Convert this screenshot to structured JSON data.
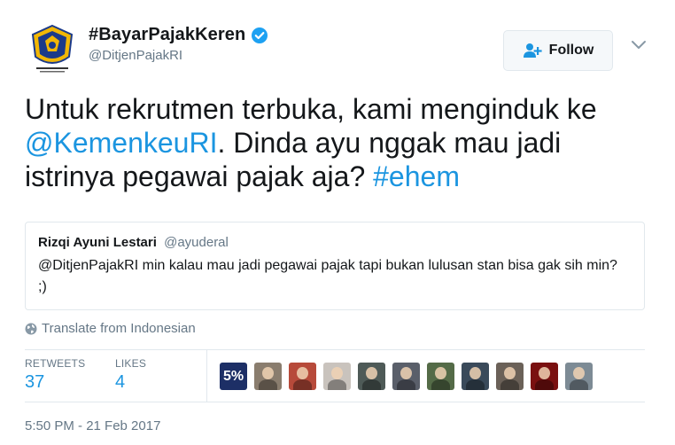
{
  "header": {
    "display_name": "#BayarPajakKeren",
    "handle": "@DitjenPajakRI",
    "avatar_icon": "ministry-of-finance-emblem",
    "verified_icon": "verified-badge-icon",
    "follow_label": "Follow",
    "follow_icon": "add-user-icon",
    "menu_icon": "chevron-down-icon"
  },
  "tweet": {
    "text_before_mention": "Untuk rekrutmen terbuka, kami menginduk ke ",
    "mention": "@KemenkeuRI",
    "text_after_mention": ". Dinda ayu nggak mau jadi istrinya pegawai pajak aja? ",
    "hashtag": "#ehem"
  },
  "quote": {
    "name": "Rizqi Ayuni Lestari",
    "handle": "@ayuderal",
    "text": "@DitjenPajakRI min kalau mau jadi pegawai pajak tapi bukan lulusan stan bisa gak sih min? ;)"
  },
  "translate": {
    "label": "Translate from Indonesian",
    "icon": "globe-icon"
  },
  "stats": {
    "retweets_label": "RETWEETS",
    "retweets_value": "37",
    "likes_label": "LIKES",
    "likes_value": "4",
    "liker_badge_text": "5%",
    "liker_colors": [
      "#1d2f66",
      "#8a7d6e",
      "#b74a3a",
      "#c9c3bd",
      "#4e5a57",
      "#5a5f6a",
      "#546b47",
      "#3a4a5a",
      "#6b6158",
      "#7a1010",
      "#7d8b95"
    ]
  },
  "meta": {
    "timestamp": "5:50 PM - 21 Feb 2017"
  },
  "colors": {
    "link": "#1b95e0",
    "muted": "#657786",
    "border": "#e1e8ed"
  }
}
